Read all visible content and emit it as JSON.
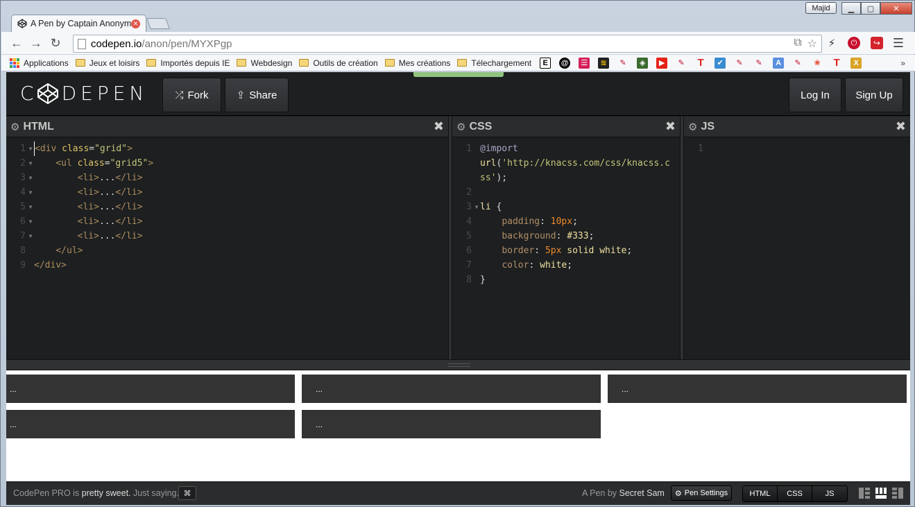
{
  "browser": {
    "profile_name": "Majid",
    "tab_title": "A Pen by Captain Anonym",
    "url_host": "codepen.io",
    "url_path": "/anon/pen/MYXPgp",
    "bookmarks": [
      {
        "label": "Applications",
        "icon": "apps-grid-icon"
      },
      {
        "label": "Jeux et loisirs",
        "icon": "folder-icon"
      },
      {
        "label": "Importés depuis IE",
        "icon": "folder-icon"
      },
      {
        "label": "Webdesign",
        "icon": "folder-icon"
      },
      {
        "label": "Outils de création",
        "icon": "folder-icon"
      },
      {
        "label": "Mes créations",
        "icon": "folder-icon"
      },
      {
        "label": "Télechargement",
        "icon": "folder-icon"
      }
    ]
  },
  "codepen": {
    "logo": "CODEPEN",
    "fork_label": "Fork",
    "share_label": "Share",
    "login_label": "Log In",
    "signup_label": "Sign Up",
    "panes": {
      "html": "HTML",
      "css": "CSS",
      "js": "JS"
    },
    "html_lines": [
      "<div class=\"grid\">",
      "    <ul class=\"grid5\">",
      "        <li>...</li>",
      "        <li>...</li>",
      "        <li>...</li>",
      "        <li>...</li>",
      "        <li>...</li>",
      "    </ul>",
      "</div>"
    ],
    "css_lines": [
      "@import",
      "url('http://knacss.com/css/knacss.c",
      "ss');",
      "",
      "li {",
      "    padding: 10px;",
      "    background: #333;",
      "    border: 5px solid white;",
      "    color: white;",
      "}"
    ],
    "js_first_line": "1",
    "preview_items": [
      "...",
      "...",
      "...",
      "...",
      "..."
    ],
    "footer": {
      "promo_a": "CodePen PRO",
      "promo_b": " is ",
      "promo_c": "pretty sweet.",
      "promo_d": " Just saying.",
      "kbd": "⌘",
      "byline_a": "A Pen by ",
      "author": "Secret Sam",
      "pen_settings": "Pen Settings",
      "view_html": "HTML",
      "view_css": "CSS",
      "view_js": "JS"
    }
  },
  "colors": {
    "editor_bg": "#1d1f20",
    "preview_cell": "#333333",
    "accent_green": "#8fc37f"
  }
}
